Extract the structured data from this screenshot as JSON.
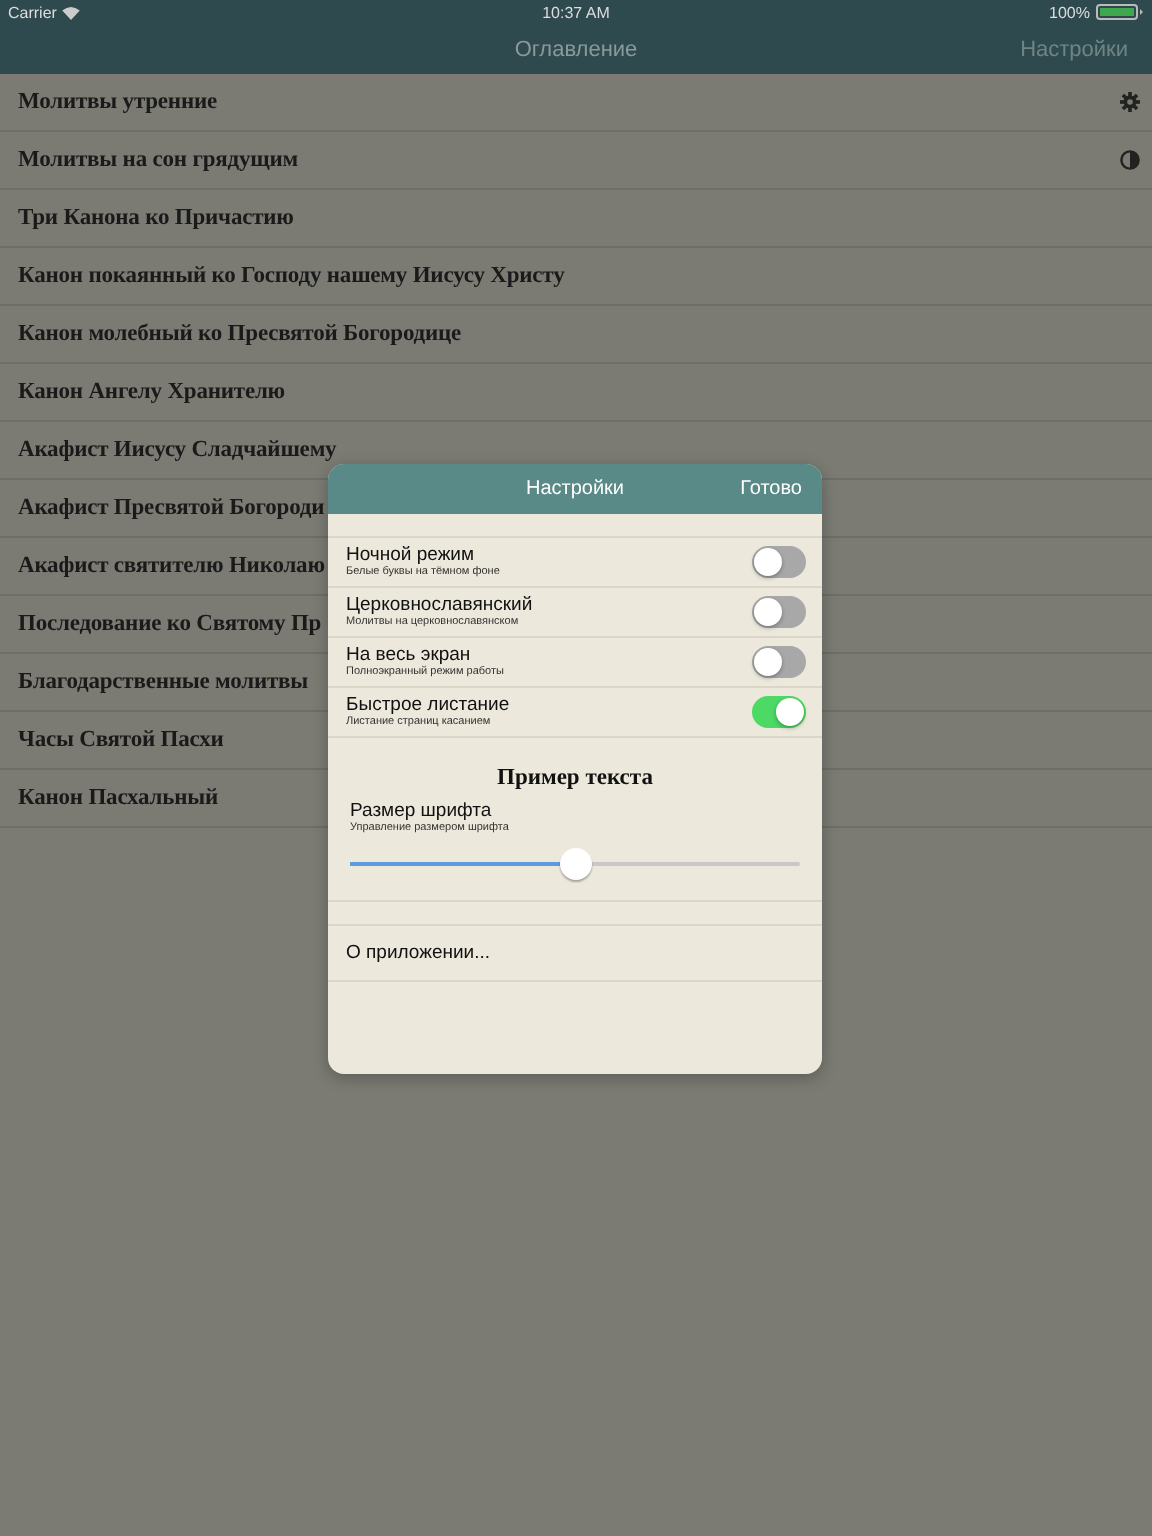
{
  "status_bar": {
    "carrier": "Carrier",
    "time": "10:37 AM",
    "battery": "100%"
  },
  "nav_bar": {
    "title": "Оглавление",
    "right_button": "Настройки"
  },
  "contents": [
    {
      "title": "Молитвы утренние",
      "kind": "gear"
    },
    {
      "title": "Молитвы на сон грядущим",
      "kind": "contrast"
    },
    {
      "title": "Три Канона ко Причастию"
    },
    {
      "title": "Канон покаянный ко Господу нашему Иисусу Христу"
    },
    {
      "title": "Канон молебный ко Пресвятой Богородице"
    },
    {
      "title": "Канон Ангелу Хранителю"
    },
    {
      "title": "Акафист Иисусу Сладчайшему"
    },
    {
      "title": "Акафист Пресвятой Богороди"
    },
    {
      "title": "Акафист святителю Николаю"
    },
    {
      "title": "Последование ко Святому Пр"
    },
    {
      "title": "Благодарственные молитвы"
    },
    {
      "title": "Часы Святой Пасхи"
    },
    {
      "title": "Канон Пасхальный"
    }
  ],
  "settings_popover": {
    "title": "Настройки",
    "done_button": "Готово",
    "toggles": [
      {
        "label": "Ночной режим",
        "subtitle": "Белые буквы на тёмном фоне",
        "on": false
      },
      {
        "label": "Церковнославянский",
        "subtitle": "Молитвы на церковнославянском",
        "on": false
      },
      {
        "label": "На весь экран",
        "subtitle": "Полноэкранный режим работы",
        "on": false
      },
      {
        "label": "Быстрое листание",
        "subtitle": "Листание страниц касанием",
        "on": true
      }
    ],
    "sample_text": "Пример текста",
    "font_size": {
      "label": "Размер шрифта",
      "subtitle": "Управление размером шрифта",
      "level": 0.5
    },
    "about": "О приложении..."
  }
}
